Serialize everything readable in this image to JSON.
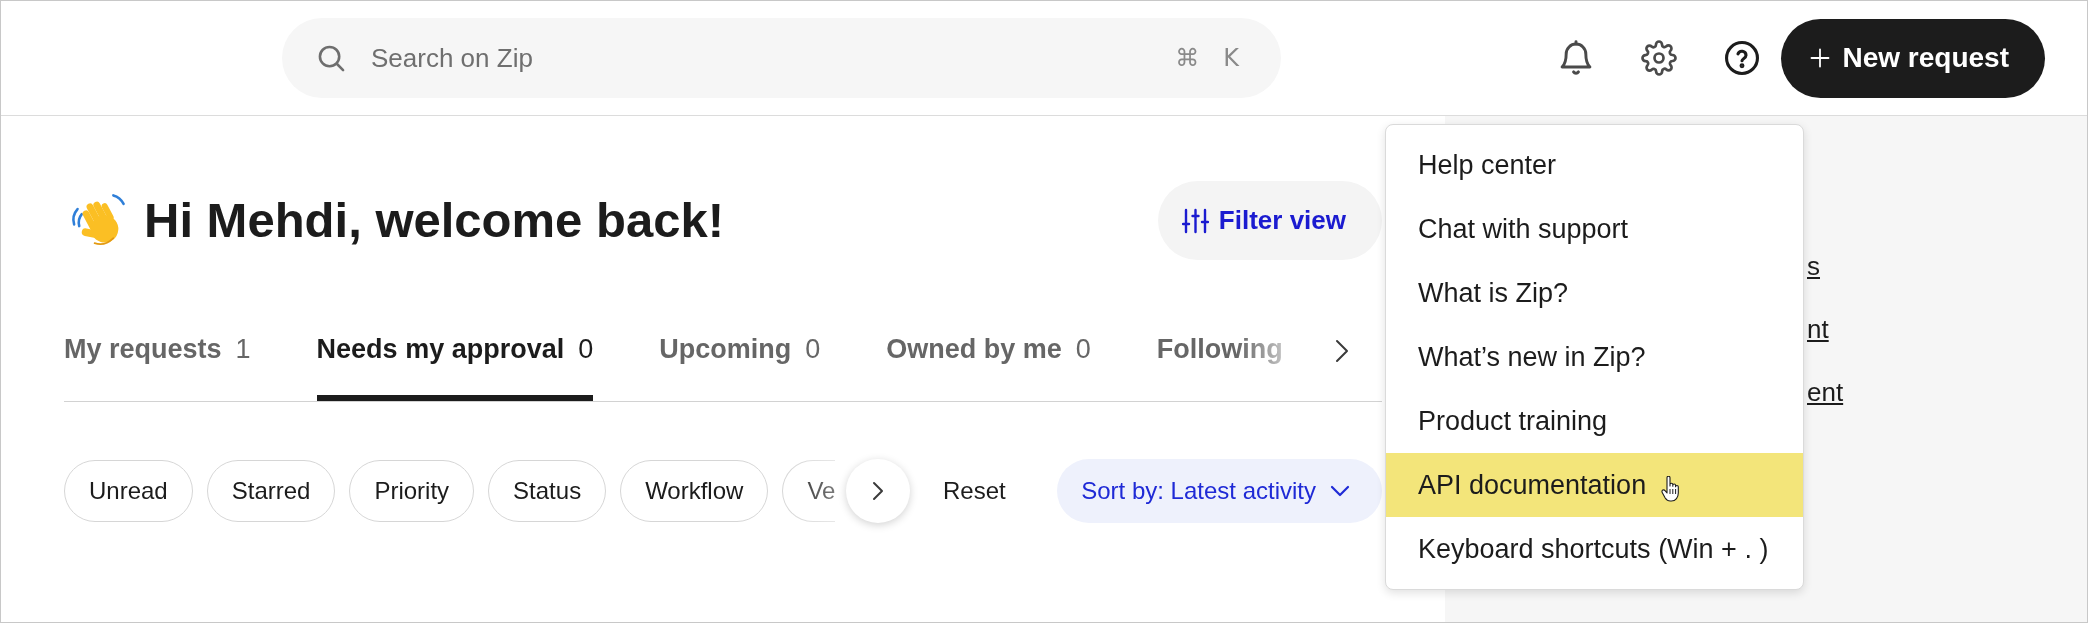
{
  "topbar": {
    "search": {
      "placeholder": "Search on Zip",
      "shortcut_keys": [
        "⌘",
        "K"
      ]
    },
    "new_request_button": {
      "label": "New request"
    }
  },
  "greeting": {
    "heading": "Hi Mehdi, welcome back!",
    "filter_button": {
      "label": "Filter view"
    }
  },
  "tabs": [
    {
      "label": "My requests",
      "count": "1",
      "selected": false
    },
    {
      "label": "Needs my approval",
      "count": "0",
      "selected": true
    },
    {
      "label": "Upcoming",
      "count": "0",
      "selected": false
    },
    {
      "label": "Owned by me",
      "count": "0",
      "selected": false
    },
    {
      "label": "Following",
      "selected": false
    }
  ],
  "filters": {
    "chips": [
      {
        "label": "Unread"
      },
      {
        "label": "Starred"
      },
      {
        "label": "Priority"
      },
      {
        "label": "Status"
      },
      {
        "label": "Workflow"
      },
      {
        "label": "Ve"
      }
    ],
    "reset": {
      "label": "Reset"
    },
    "sort": {
      "label": "Sort by: Latest activity"
    }
  },
  "side_panel": {
    "links": [
      "s",
      "nt",
      "ent"
    ]
  },
  "help_menu": {
    "items": [
      {
        "label": "Help center",
        "highlighted": false
      },
      {
        "label": "Chat with support",
        "highlighted": false
      },
      {
        "label": "What is Zip?",
        "highlighted": false
      },
      {
        "label": "What’s new in Zip?",
        "highlighted": false
      },
      {
        "label": "Product training",
        "highlighted": false
      },
      {
        "label": "API documentation",
        "highlighted": true
      },
      {
        "label": "Keyboard shortcuts (Win + . )",
        "highlighted": false
      }
    ]
  }
}
